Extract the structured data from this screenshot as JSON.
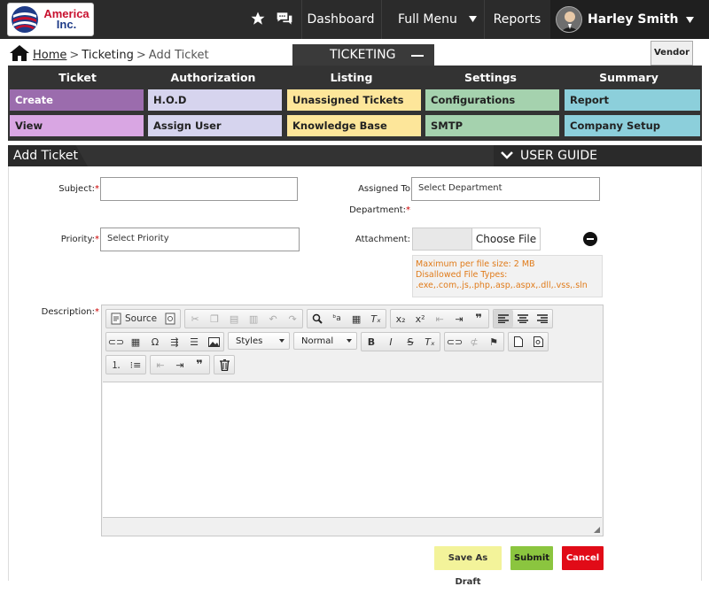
{
  "brand": {
    "line1": "America",
    "line2": "Inc."
  },
  "nav": {
    "dashboard": "Dashboard",
    "full_menu": "Full Menu",
    "reports": "Reports",
    "user_name": "Harley Smith"
  },
  "breadcrumb": {
    "home": "Home",
    "sep1": ">",
    "ticketing": "Ticketing",
    "sep2": ">",
    "current": "Add Ticket"
  },
  "module_tab": "TICKETING",
  "vendor": "Vendor",
  "menu": {
    "headers": [
      "Ticket",
      "Authorization",
      "Listing",
      "Settings",
      "Summary"
    ],
    "row1": [
      "Create",
      "H.O.D",
      "Unassigned Tickets",
      "Configurations",
      "Report"
    ],
    "row2": [
      "View",
      "Assign User",
      "Knowledge Base",
      "SMTP",
      "Company Setup"
    ]
  },
  "section": {
    "title": "Add Ticket",
    "guide": "USER GUIDE"
  },
  "form": {
    "subject_label": "Subject:",
    "assigned_label": "Assigned To",
    "assigned_label2": "Department:",
    "assigned_value": "Select Department",
    "priority_label": "Priority:",
    "priority_value": "Select Priority",
    "attachment_label": "Attachment:",
    "choose_file": "Choose File",
    "info1": "Maximum per file size: 2 MB",
    "info2": "Disallowed File Types:",
    "info3": ".exe,.com,.js,.php,.asp,.aspx,.dll,.vss,.sln",
    "description_label": "Description:",
    "required_mark": "*"
  },
  "editor": {
    "source": "Source",
    "styles": "Styles",
    "format": "Normal"
  },
  "actions": {
    "draft": "Save As Draft",
    "submit": "Submit",
    "cancel": "Cancel"
  },
  "colors": {
    "create": "#9b6cad",
    "view": "#d9a6e3",
    "auth": "#d6d4ee",
    "listing": "#fde69a",
    "settings": "#a5d2ae",
    "summary": "#8ccfdb",
    "draft": "#f3f39a",
    "submit": "#8bc53f",
    "cancel": "#e10b17"
  }
}
